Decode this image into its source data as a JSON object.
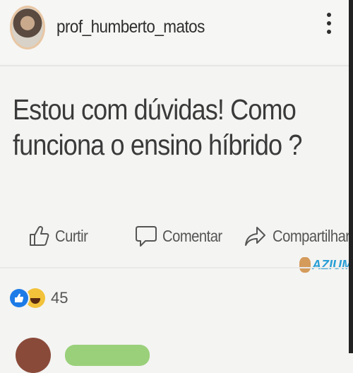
{
  "header": {
    "username": "prof_humberto_matos"
  },
  "post": {
    "line1": "Estou com dúvidas!  Como",
    "line2": "funciona o ensino híbrido ?"
  },
  "actions": {
    "like": "Curtir",
    "comment": "Comentar",
    "share": "Compartilhar"
  },
  "watermark": "AZIUME",
  "reactions": {
    "count": "45"
  },
  "colors": {
    "like_blue": "#1d7be7",
    "watermark_blue": "#2a9fd6"
  }
}
